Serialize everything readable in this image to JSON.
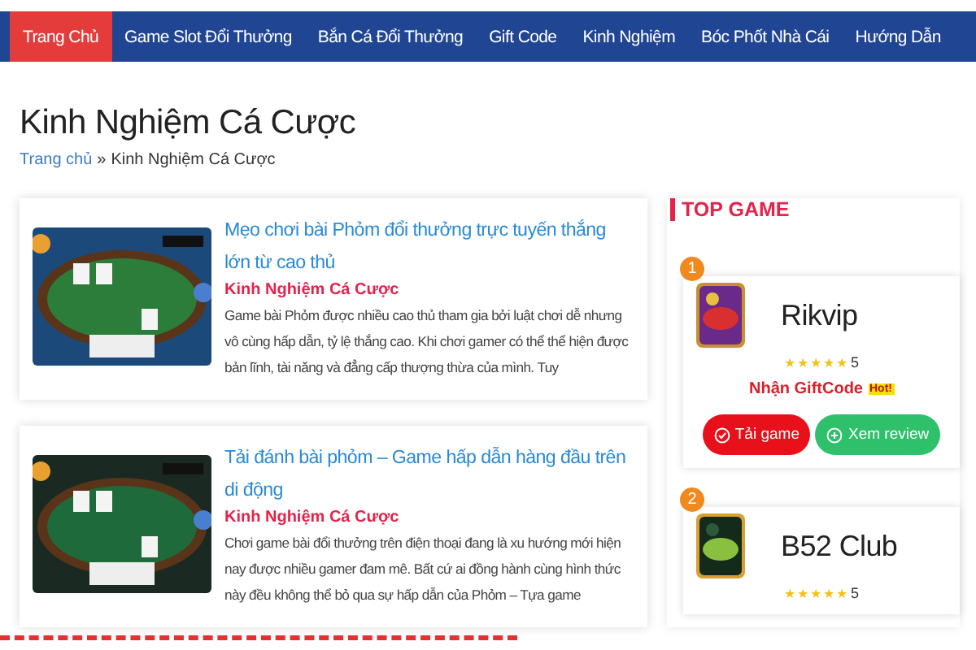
{
  "nav": [
    {
      "label": "Trang Chủ",
      "selected": true
    },
    {
      "label": "Game Slot Đổi Thưởng",
      "selected": false
    },
    {
      "label": "Bắn Cá Đổi Thưởng",
      "selected": false
    },
    {
      "label": "Gift Code",
      "selected": false
    },
    {
      "label": "Kinh Nghiệm",
      "selected": false
    },
    {
      "label": "Bóc Phốt Nhà Cái",
      "selected": false
    },
    {
      "label": "Hướng Dẫn",
      "selected": false
    }
  ],
  "page_title": "Kinh Nghiệm Cá Cược",
  "breadcrumb": {
    "link": "Trang chủ",
    "separator": "»",
    "current": "Kinh Nghiệm Cá Cược"
  },
  "posts": [
    {
      "title": "Mẹo chơi bài Phỏm đổi thưởng trực tuyến thắng lớn từ cao thủ",
      "category": "Kinh Nghiệm Cá Cược",
      "excerpt": "Game bài Phỏm được nhiều cao thủ tham gia bởi luật chơi dễ nhưng vô cùng hấp dẫn, tỷ lệ thắng cao. Khi chơi gamer có thể thể hiện được bản lĩnh, tài năng và đẳng cấp thượng thừa của mình. Tuy"
    },
    {
      "title": "Tải đánh bài phỏm – Game hấp dẫn hàng đầu trên di động",
      "category": "Kinh Nghiệm Cá Cược",
      "excerpt": "Chơi game bài đổi thưởng trên điện thoại đang là xu hướng mới hiện nay được nhiều gamer đam mê. Bất cứ ai đồng hành cùng hình thức này đều không thể bỏ qua sự hấp dẫn của Phỏm – Tựa game"
    }
  ],
  "sidebar": {
    "heading": "TOP GAME",
    "games": [
      {
        "rank": "1",
        "name": "Rikvip",
        "stars": 5,
        "rating": "5",
        "giftcode": "Nhận GiftCode",
        "badge": "Hot!",
        "buttons": [
          "Tải game",
          "Xem review"
        ]
      },
      {
        "rank": "2",
        "name": "B52 Club",
        "stars": 5,
        "rating": "5"
      }
    ]
  }
}
